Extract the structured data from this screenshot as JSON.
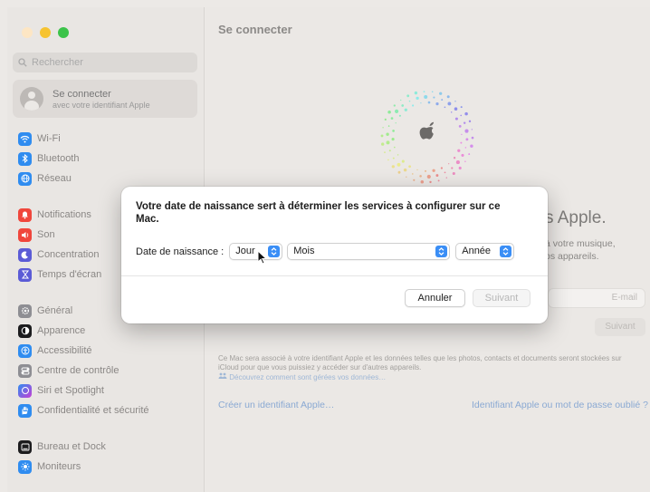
{
  "sidebar": {
    "search_placeholder": "Rechercher",
    "account": {
      "title": "Se connecter",
      "subtitle": "avec votre identifiant Apple"
    },
    "items": [
      {
        "label": "Wi-Fi",
        "icon": "wifi-icon",
        "color": "#2f8cf0"
      },
      {
        "label": "Bluetooth",
        "icon": "bluetooth-icon",
        "color": "#2f8cf0"
      },
      {
        "label": "Réseau",
        "icon": "globe-icon",
        "color": "#2f8cf0"
      },
      {
        "label": "Notifications",
        "icon": "bell-icon",
        "color": "#f0463c"
      },
      {
        "label": "Son",
        "icon": "speaker-icon",
        "color": "#f0463c"
      },
      {
        "label": "Concentration",
        "icon": "moon-icon",
        "color": "#5b5bd6"
      },
      {
        "label": "Temps d'écran",
        "icon": "hourglass-icon",
        "color": "#5b5bd6"
      },
      {
        "label": "Général",
        "icon": "gear-icon",
        "color": "#8e8e93"
      },
      {
        "label": "Apparence",
        "icon": "appearance-icon",
        "color": "#1c1c1e"
      },
      {
        "label": "Accessibilité",
        "icon": "accessibility-icon",
        "color": "#2f8cf0"
      },
      {
        "label": "Centre de contrôle",
        "icon": "control-center-icon",
        "color": "#8e8e93"
      },
      {
        "label": "Siri et Spotlight",
        "icon": "siri-icon",
        "color": "#6e4bd8"
      },
      {
        "label": "Confidentialité et sécurité",
        "icon": "hand-icon",
        "color": "#2f8cf0"
      },
      {
        "label": "Bureau et Dock",
        "icon": "dock-icon",
        "color": "#1c1c1e"
      },
      {
        "label": "Moniteurs",
        "icon": "sun-icon",
        "color": "#2f8cf0"
      }
    ]
  },
  "main": {
    "title": "Se connecter",
    "heading": "s Apple.",
    "desc_line1": "à votre musique,",
    "desc_line2": "os appareils.",
    "email_placeholder": "E-mail",
    "next_label": "Suivant",
    "smallprint": "Ce Mac sera associé à votre identifiant Apple et les données telles que les photos, contacts et documents seront stockées sur iCloud pour que vous puissiez y accéder sur d'autres appareils.",
    "smallprint_link": "Découvrez comment sont gérées vos données…",
    "create_link": "Créer un identifiant Apple…",
    "forgot_link": "Identifiant Apple ou mot de passe oublié ?"
  },
  "dialog": {
    "title": "Votre date de naissance sert à déterminer les services à configurer sur ce Mac.",
    "birth_label": "Date de naissance :",
    "day_value": "Jour",
    "month_value": "Mois",
    "year_value": "Année",
    "cancel_label": "Annuler",
    "next_label": "Suivant"
  },
  "colors": {
    "accent": "#3a8ef6",
    "link": "#8aa9d3"
  }
}
